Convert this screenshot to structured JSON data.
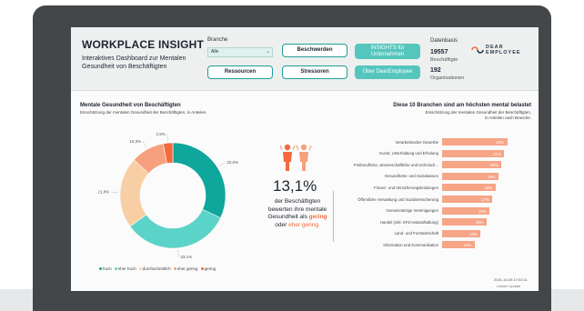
{
  "header": {
    "title": "WORKPLACE INSIGHT",
    "subtitle": "Interaktives Dashboard zur Mentalen Gesundheit von Beschäftigten",
    "branche_label": "Branche",
    "branche_value": "Alle",
    "buttons": {
      "beschwerden": "Beschwerden",
      "insights": "INSIGHTS für Unternehmen",
      "ressourcen": "Ressourcen",
      "stressoren": "Stressoren",
      "ueber": "Über DearEmployee"
    },
    "datenbasis_label": "Datenbasis",
    "beschaeftigte_value": "19557",
    "beschaeftigte_label": "Beschäftigte",
    "organisationen_value": "192",
    "organisationen_label": "Organisationen",
    "logo_line1": "DEAR",
    "logo_line2": "EMPLOYEE"
  },
  "left_panel": {
    "title": "Mentale Gesundheit von Beschäftigten",
    "subtitle": "Einschätzung der mentalen Gesundheit der Beschäftigten, in Anteilen."
  },
  "chart_data": [
    {
      "type": "pie",
      "categories": [
        "hoch",
        "eher hoch",
        "durchschnittlich",
        "eher gering",
        "gering"
      ],
      "values": [
        32.0,
        33.1,
        21.8,
        10.3,
        2.9
      ],
      "labels": [
        "32,0%",
        "33,1%",
        "21,8%",
        "10,3%",
        "2,9%"
      ],
      "colors": [
        "#0fa69c",
        "#5cd3c8",
        "#f8cfa4",
        "#f7a07d",
        "#f26a3d"
      ],
      "legend": "bottom"
    },
    {
      "type": "bar",
      "title": "Diese 10 Branchen sind am höchsten mental belastet",
      "subtitle": "Einschätzung der mentalen Gesundheit der Beschäftigten, in Anteilen nach Branche.",
      "categories": [
        "Verarbeitendes Gewerbe",
        "Kunst, Unterhaltung und Erholung",
        "Freiberufliche, wissenschaftliche und technisch...",
        "Gesundheits- und Sozialwesen",
        "Finanz- und Versicherungsleistungen",
        "Öffentliche Verwaltung und Sozialversicherung",
        "Gemeinnützige Vereinigungen",
        "Handel (inkl. KFZ-Instandhaltung)",
        "Land- und Forstwirtschaft",
        "Information und Kommunikation"
      ],
      "values": [
        22,
        21,
        20,
        19,
        18,
        17,
        16,
        15,
        13,
        11
      ],
      "value_labels": [
        "22%",
        "21%",
        "20%",
        "19%",
        "18%",
        "17%",
        "16%",
        "15%",
        "13%",
        "11%"
      ],
      "color": "#f6a586",
      "xlim": [
        0,
        24
      ]
    }
  ],
  "kpi": {
    "percent": "13,1%",
    "text_pre": "der Beschäftigten bewerten ihre mentale Gesundheit als",
    "word1": "gering",
    "mid": "oder",
    "word2": "eher gering."
  },
  "footer": {
    "date": "2021-10-05 17:53:11",
    "label": "Letzter Update"
  },
  "colors": {
    "teal": "#0fa69c",
    "light_teal": "#5cd3c8",
    "peach": "#f8cfa4",
    "salmon": "#f7a07d",
    "orange": "#f26a3d",
    "monitor": "#434749"
  }
}
